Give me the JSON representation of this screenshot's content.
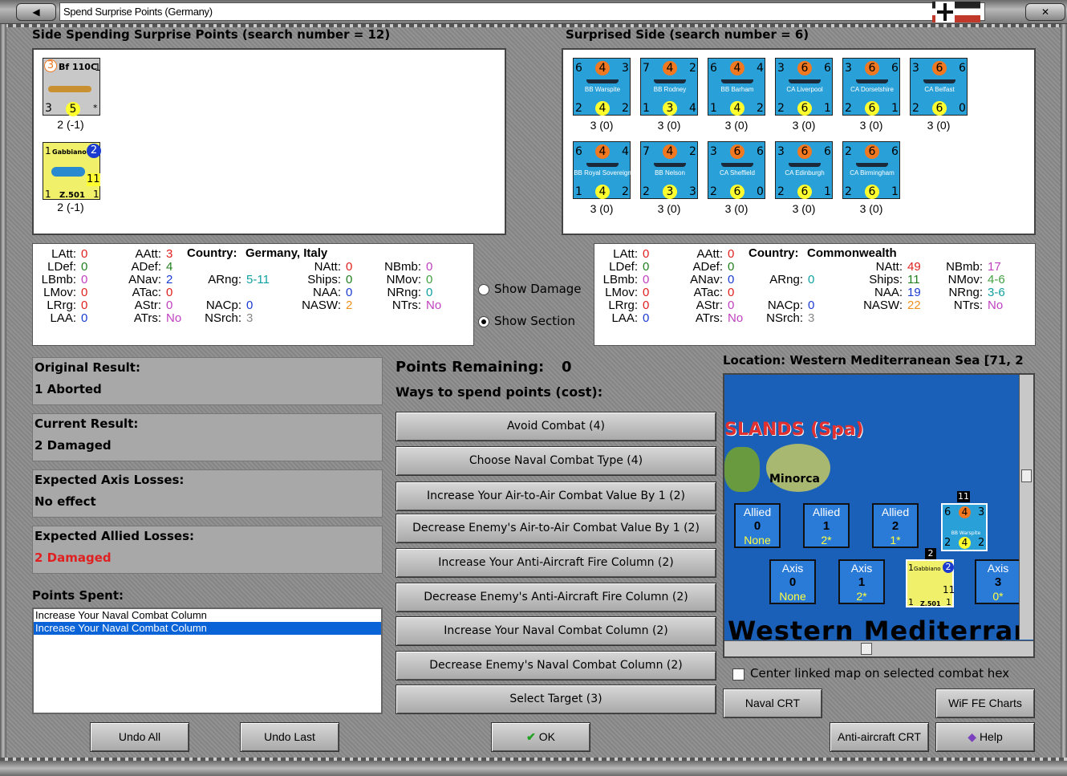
{
  "window": {
    "title": "Spend Surprise Points (Germany)"
  },
  "headers": {
    "left": "Side Spending Surprise Points (search number = 12)",
    "right": "Surprised Side (search number = 6)"
  },
  "own_units": [
    {
      "name": "Bf 110C",
      "num": "1",
      "tl": "3",
      "bl": "3",
      "bm": "5",
      "br": "*",
      "strength": "2 (-1)"
    },
    {
      "name": "Gabbiano",
      "model": "Z.501",
      "tl": "1",
      "tr": "2",
      "mid": "11",
      "bl": "1",
      "br": "1",
      "strength": "2 (-1)"
    }
  ],
  "enemy_units": [
    {
      "name": "BB Warspite",
      "tl": "6",
      "tm": "4",
      "tr": "3",
      "bl": "2",
      "bm": "4",
      "br": "2",
      "strength": "3 (0)"
    },
    {
      "name": "BB Rodney",
      "tl": "7",
      "tm": "4",
      "tr": "2",
      "bl": "1",
      "bm": "3",
      "br": "4",
      "strength": "3 (0)"
    },
    {
      "name": "BB Barham",
      "tl": "6",
      "tm": "4",
      "tr": "4",
      "bl": "1",
      "bm": "4",
      "br": "2",
      "strength": "3 (0)"
    },
    {
      "name": "CA Liverpool",
      "tl": "3",
      "tm": "6",
      "tr": "6",
      "bl": "2",
      "bm": "6",
      "br": "1",
      "strength": "3 (0)"
    },
    {
      "name": "CA Dorsetshire",
      "tl": "3",
      "tm": "6",
      "tr": "6",
      "bl": "2",
      "bm": "6",
      "br": "1",
      "strength": "3 (0)"
    },
    {
      "name": "CA Belfast",
      "tl": "3",
      "tm": "6",
      "tr": "6",
      "bl": "2",
      "bm": "6",
      "br": "0",
      "strength": "3 (0)"
    },
    {
      "name": "BB Royal Sovereign",
      "tl": "6",
      "tm": "4",
      "tr": "4",
      "bl": "1",
      "bm": "4",
      "br": "2",
      "strength": "3 (0)"
    },
    {
      "name": "BB Nelson",
      "tl": "7",
      "tm": "4",
      "tr": "2",
      "bl": "2",
      "bm": "3",
      "br": "3",
      "strength": "3 (0)"
    },
    {
      "name": "CA Sheffield",
      "tl": "3",
      "tm": "6",
      "tr": "6",
      "bl": "2",
      "bm": "6",
      "br": "0",
      "strength": "3 (0)"
    },
    {
      "name": "CA Edinburgh",
      "tl": "3",
      "tm": "6",
      "tr": "6",
      "bl": "2",
      "bm": "6",
      "br": "1",
      "strength": "3 (0)"
    },
    {
      "name": "CA Birmingham",
      "tl": "2",
      "tm": "6",
      "tr": "6",
      "bl": "2",
      "bm": "6",
      "br": "1",
      "strength": "3 (0)"
    }
  ],
  "left_stats": {
    "country_label": "Country:",
    "country": "Germany, Italy",
    "LAtt": "0",
    "LDef": "0",
    "LBmb": "0",
    "LMov": "0",
    "LRrg": "0",
    "LAA": "0",
    "AAtt": "3",
    "ADef": "4",
    "ANav": "2",
    "ATac": "0",
    "AStr": "0",
    "ATrs": "No",
    "ARng": "5-11",
    "NACp": "0",
    "NSrch": "3",
    "NAtt": "0",
    "Ships": "0",
    "NAA": "0",
    "NASW": "2",
    "NBmb": "0",
    "NMov": "0",
    "NRng": "0",
    "NTrs": "No"
  },
  "right_stats": {
    "country_label": "Country:",
    "country": "Commonwealth",
    "LAtt": "0",
    "LDef": "0",
    "LBmb": "0",
    "LMov": "0",
    "LRrg": "0",
    "LAA": "0",
    "AAtt": "0",
    "ADef": "0",
    "ANav": "0",
    "ATac": "0",
    "AStr": "0",
    "ATrs": "No",
    "ARng": "0",
    "NACp": "0",
    "NSrch": "3",
    "NAtt": "49",
    "Ships": "11",
    "NAA": "19",
    "NASW": "22",
    "NBmb": "17",
    "NMov": "4-6",
    "NRng": "3-6",
    "NTrs": "No"
  },
  "labels": {
    "LAtt": "LAtt:",
    "LDef": "LDef:",
    "LBmb": "LBmb:",
    "LMov": "LMov:",
    "LRrg": "LRrg:",
    "LAA": "LAA:",
    "AAtt": "AAtt:",
    "ADef": "ADef:",
    "ANav": "ANav:",
    "ATac": "ATac:",
    "AStr": "AStr:",
    "ATrs": "ATrs:",
    "ARng": "ARng:",
    "NACp": "NACp:",
    "NSrch": "NSrch:",
    "NAtt": "NAtt:",
    "Ships": "Ships:",
    "NAA": "NAA:",
    "NASW": "NASW:",
    "NBmb": "NBmb:",
    "NMov": "NMov:",
    "NRng": "NRng:",
    "NTrs": "NTrs:"
  },
  "options": {
    "show_damage": "Show Damage",
    "show_section": "Show Section",
    "selected": "show_section"
  },
  "results": [
    {
      "label": "Original Result:",
      "value": "1 Aborted"
    },
    {
      "label": "Current Result:",
      "value": "2 Damaged"
    },
    {
      "label": "Expected Axis Losses:",
      "value": "No effect"
    },
    {
      "label": "Expected Allied Losses:",
      "value": "2 Damaged"
    }
  ],
  "points": {
    "label": "Points Remaining:",
    "value": "0",
    "ways": "Ways to spend points (cost):",
    "spent_label": "Points Spent:",
    "spent": [
      "Increase Your Naval Combat Column",
      "Increase Your Naval Combat Column"
    ]
  },
  "actions": [
    "Avoid Combat (4)",
    "Choose Naval Combat Type (4)",
    "Increase Your Air-to-Air Combat Value By 1 (2)",
    "Decrease Enemy's Air-to-Air Combat Value By 1 (2)",
    "Increase Your Anti-Aircraft Fire Column (2)",
    "Decrease Enemy's Anti-Aircraft Fire Column (2)",
    "Increase Your Naval Combat Column (2)",
    "Decrease Enemy's Naval Combat Column (2)",
    "Select Target (3)"
  ],
  "location": {
    "label": "Location: Western Mediterranean Sea [71, 2",
    "islands": "SLANDS (Spa)",
    "island": "Minorca",
    "sea": "Western Mediterran",
    "allied": [
      {
        "a": "Allied",
        "n": "0",
        "s": "None"
      },
      {
        "a": "Allied",
        "n": "1",
        "s": "2*"
      },
      {
        "a": "Allied",
        "n": "2",
        "s": "1*"
      }
    ],
    "axis": [
      {
        "a": "Axis",
        "n": "0",
        "s": "None"
      },
      {
        "a": "Axis",
        "n": "1",
        "s": "2*"
      },
      {
        "a": "Axis",
        "n": "3",
        "s": "0*"
      }
    ],
    "stack_count_1": "11",
    "stack_count_2": "2",
    "map_ship": {
      "tl": "6",
      "tm": "4",
      "tr": "3",
      "name": "BB Warspite",
      "bl": "2",
      "bm": "4",
      "br": "2"
    },
    "map_air": {
      "name": "Gabbiano",
      "tl": "1",
      "tr": "2",
      "mid": "11",
      "model": "Z.501",
      "bl": "1",
      "br": "1"
    }
  },
  "center_map": "Center linked map on selected combat hex",
  "buttons": {
    "undo_all": "Undo All",
    "undo_last": "Undo Last",
    "ok": "OK",
    "naval_crt": "Naval CRT",
    "wif_fe": "WiF FE Charts",
    "aa_crt": "Anti-aircraft CRT",
    "help": "Help"
  },
  "colors": {
    "accent_selection": "#0a64d8",
    "naval_counter": "#2aa0d8",
    "allied_loss": "#e02020"
  }
}
